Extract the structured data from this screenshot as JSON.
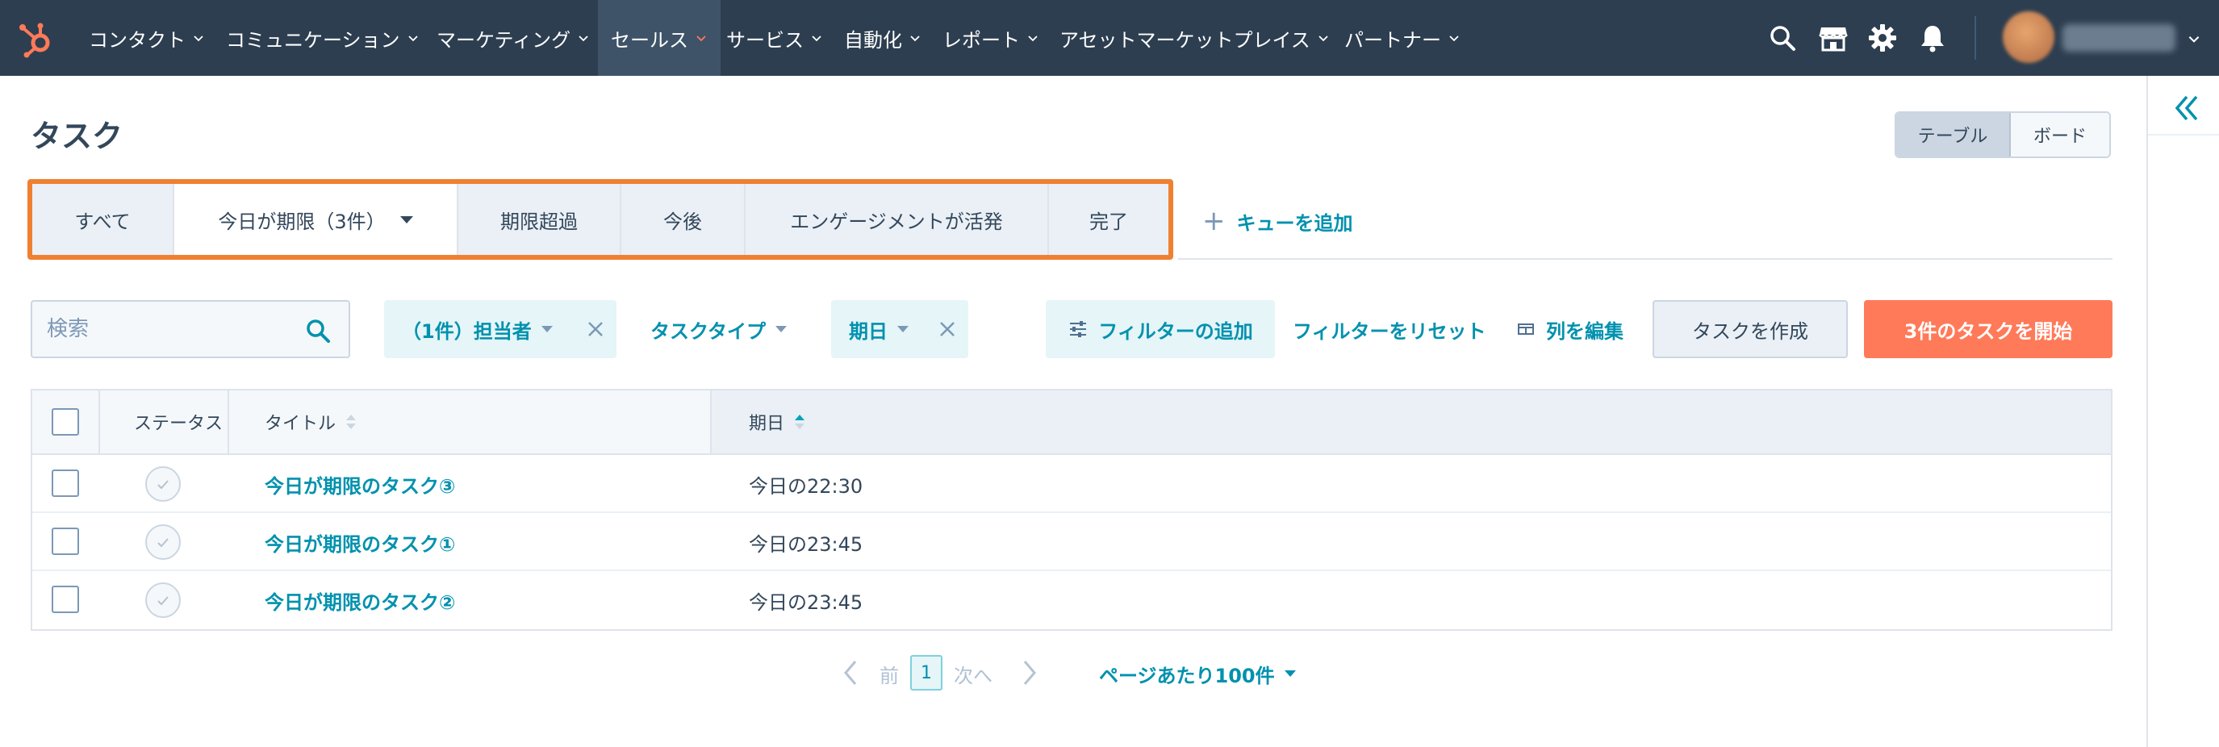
{
  "nav": {
    "items": [
      {
        "label": "コンタクト"
      },
      {
        "label": "コミュニケーション"
      },
      {
        "label": "マーケティング"
      },
      {
        "label": "セールス"
      },
      {
        "label": "サービス"
      },
      {
        "label": "自動化"
      },
      {
        "label": "レポート"
      },
      {
        "label": "アセットマーケットプレイス"
      },
      {
        "label": "パートナー"
      }
    ],
    "active": "セールス",
    "icons": [
      "search-icon",
      "marketplace-icon",
      "settings-icon",
      "notifications-icon"
    ]
  },
  "page": {
    "title": "タスク"
  },
  "view_toggle": {
    "table": "テーブル",
    "board": "ボード",
    "selected": "テーブル"
  },
  "queue_tabs": {
    "tabs": [
      {
        "label": "すべて"
      },
      {
        "label": "今日が期限（3件）"
      },
      {
        "label": "期限超過"
      },
      {
        "label": "今後"
      },
      {
        "label": "エンゲージメントが活発"
      },
      {
        "label": "完了"
      }
    ],
    "active": "今日が期限（3件）",
    "add_queue": "キューを追加"
  },
  "filters": {
    "search_placeholder": "検索",
    "assignee": "（1件）担当者",
    "task_type": "タスクタイプ",
    "due_date": "期日",
    "add_filter": "フィルターの追加",
    "reset": "フィルターをリセット",
    "edit_columns": "列を編集",
    "create_task": "タスクを作成",
    "start_tasks": "3件のタスクを開始"
  },
  "table": {
    "headers": {
      "status": "ステータス",
      "title": "タイトル",
      "due": "期日"
    },
    "sorted_column": "期日",
    "rows": [
      {
        "title": "今日が期限のタスク③",
        "due": "今日の22:30"
      },
      {
        "title": "今日が期限のタスク①",
        "due": "今日の23:45"
      },
      {
        "title": "今日が期限のタスク②",
        "due": "今日の23:45"
      }
    ]
  },
  "pagination": {
    "prev": "前",
    "page": "1",
    "next": "次へ",
    "per_page": "ページあたり100件"
  },
  "colors": {
    "nav_bg": "#2d3e50",
    "accent_teal": "#0091ae",
    "primary_orange": "#ff7a59",
    "highlight_orange": "#f08031"
  }
}
